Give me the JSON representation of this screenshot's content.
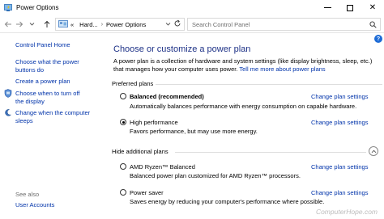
{
  "window": {
    "title": "Power Options",
    "icon": "power-options-icon",
    "controls": {
      "minimize": "minimize-icon",
      "maximize": "maximize-icon",
      "close": "✕"
    }
  },
  "navigation": {
    "breadcrumb": [
      "Hard...",
      "Power Options"
    ],
    "separator": "›",
    "prefix": "«",
    "search": {
      "placeholder": "Search Control Panel",
      "value": ""
    }
  },
  "sidebar": {
    "items": [
      {
        "label": "Control Panel Home"
      },
      {
        "label": "Choose what the power"
      },
      {
        "label": "buttons do"
      },
      {
        "label": "Create a power plan"
      },
      {
        "label": "Choose when to turn off"
      },
      {
        "label": "the display"
      },
      {
        "label": "Change when the computer"
      },
      {
        "label": "sleeps"
      }
    ],
    "see_also": {
      "heading": "See also",
      "items": [
        {
          "label": "User Accounts"
        }
      ]
    }
  },
  "main": {
    "help": "?",
    "title": "Choose or customize a power plan",
    "intro": "A power plan is a collection of hardware and system settings (like display brightness, sleep, etc.) that manages how your computer uses power.",
    "intro_link": "Tell me more about power plans",
    "preferred": {
      "heading": "Preferred plans",
      "plans": [
        {
          "name": "Balanced (recommended)",
          "description": "Automatically balances performance with energy consumption on capable hardware.",
          "link": "Change plan settings",
          "selected": false,
          "bold": true
        },
        {
          "name": "High performance",
          "description": "Favors performance, but may use more energy.",
          "link": "Change plan settings",
          "selected": true,
          "bold": false
        }
      ]
    },
    "additional": {
      "heading": "Hide additional plans",
      "plans": [
        {
          "name": "AMD Ryzen™ Balanced",
          "description": "Balanced power plan customized for AMD Ryzen™ processors.",
          "link": "Change plan settings",
          "selected": false
        },
        {
          "name": "Power saver",
          "description": "Saves energy by reducing your computer's performance where possible.",
          "link": "Change plan settings",
          "selected": false
        }
      ]
    }
  },
  "watermark": "ComputerHope.com",
  "colors": {
    "link": "#0033aa",
    "title": "#1e3287",
    "help": "#1d6bd6"
  }
}
